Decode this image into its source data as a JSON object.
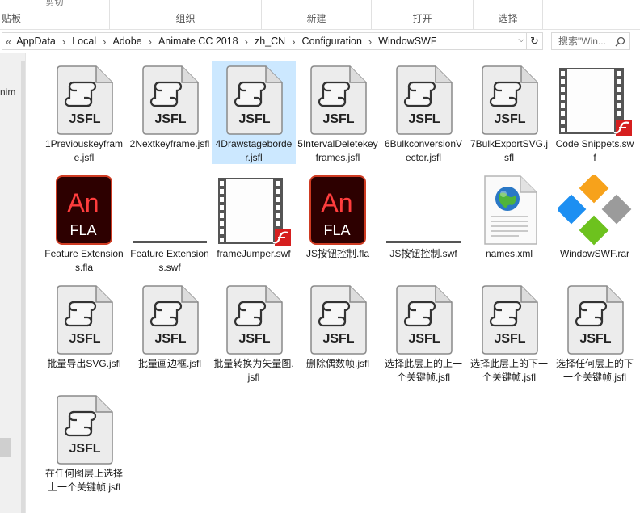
{
  "ribbon": {
    "sections": [
      {
        "label": "贴板",
        "top_text": "剪切"
      },
      {
        "label": "组织",
        "top_text": ""
      },
      {
        "label": "新建",
        "top_text": ""
      },
      {
        "label": "打开",
        "top_text": ""
      },
      {
        "label": "选择",
        "top_text": ""
      }
    ]
  },
  "address": {
    "path": [
      "AppData",
      "Local",
      "Adobe",
      "Animate CC 2018",
      "zh_CN",
      "Configuration",
      "WindowSWF"
    ],
    "leading": "«"
  },
  "search": {
    "placeholder": "搜索\"Win..."
  },
  "nav": {
    "partial_label": "nim"
  },
  "files": [
    {
      "name": "1Previouskeyframe.jsfl",
      "type": "jsfl",
      "selected": false
    },
    {
      "name": "2Nextkeyframe.jsfl",
      "type": "jsfl",
      "selected": false
    },
    {
      "name": "4Drawstageborder.jsfl",
      "type": "jsfl",
      "selected": true
    },
    {
      "name": "5IntervalDeletekeyframes.jsfl",
      "type": "jsfl",
      "selected": false
    },
    {
      "name": "6BulkconversionVector.jsfl",
      "type": "jsfl",
      "selected": false
    },
    {
      "name": "7BulkExportSVG.jsfl",
      "type": "jsfl",
      "selected": false
    },
    {
      "name": "Code Snippets.swf",
      "type": "swf-film",
      "selected": false
    },
    {
      "name": "Feature Extensions.fla",
      "type": "fla",
      "selected": false
    },
    {
      "name": "Feature Extensions.swf",
      "type": "swf-blank",
      "selected": false
    },
    {
      "name": "frameJumper.swf",
      "type": "swf-film",
      "selected": false
    },
    {
      "name": "JS按钮控制.fla",
      "type": "fla",
      "selected": false
    },
    {
      "name": "JS按钮控制.swf",
      "type": "swf-blank",
      "selected": false
    },
    {
      "name": "names.xml",
      "type": "xml",
      "selected": false
    },
    {
      "name": "WindowSWF.rar",
      "type": "rar",
      "selected": false
    },
    {
      "name": "批量导出SVG.jsfl",
      "type": "jsfl",
      "selected": false
    },
    {
      "name": "批量画边框.jsfl",
      "type": "jsfl",
      "selected": false
    },
    {
      "name": "批量转换为矢量图.jsfl",
      "type": "jsfl",
      "selected": false
    },
    {
      "name": "删除偶数帧.jsfl",
      "type": "jsfl",
      "selected": false
    },
    {
      "name": "选择此层上的上一个关键帧.jsfl",
      "type": "jsfl",
      "selected": false
    },
    {
      "name": "选择此层上的下一个关键帧.jsfl",
      "type": "jsfl",
      "selected": false
    },
    {
      "name": "选择任何层上的下一个关键帧.jsfl",
      "type": "jsfl",
      "selected": false
    },
    {
      "name": "在任何图层上选择上一个关键帧.jsfl",
      "type": "jsfl",
      "selected": false
    }
  ],
  "icon_text": {
    "jsfl": "JSFL",
    "fla_big": "An",
    "fla_small": "FLA"
  },
  "colors": {
    "selection": "#cce8ff",
    "fla_bg": "#2d0000",
    "fla_accent": "#ff3d3d",
    "flash_red": "#d61f1f"
  }
}
